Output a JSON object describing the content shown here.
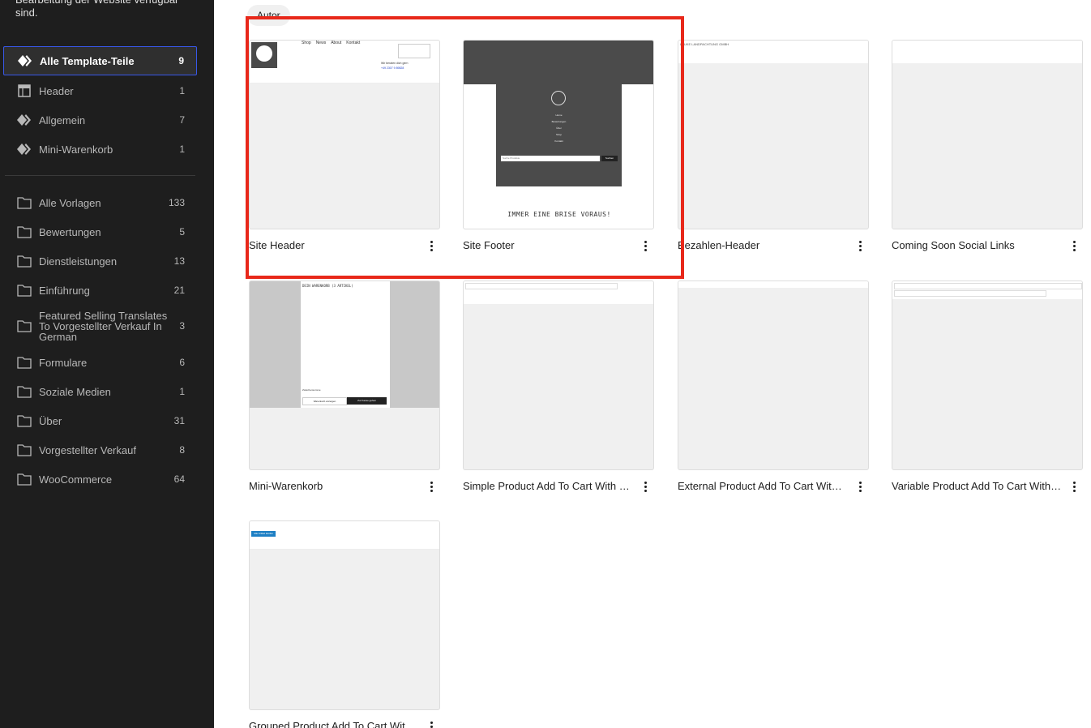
{
  "sidebar": {
    "description": "Bearbeitung der Website verfügbar sind.",
    "areas": [
      {
        "label": "Alle Template-Teile",
        "count": "9",
        "icon": "template-parts-icon",
        "active": true
      },
      {
        "label": "Header",
        "count": "1",
        "icon": "header-icon"
      },
      {
        "label": "Allgemein",
        "count": "7",
        "icon": "template-parts-icon"
      },
      {
        "label": "Mini-Warenkorb",
        "count": "1",
        "icon": "template-parts-icon"
      }
    ],
    "categories": [
      {
        "label": "Alle Vorlagen",
        "count": "133"
      },
      {
        "label": "Bewertungen",
        "count": "5"
      },
      {
        "label": "Dienstleistungen",
        "count": "13"
      },
      {
        "label": "Einführung",
        "count": "21"
      },
      {
        "label": "Featured Selling Translates To Vorgestellter Verkauf In German",
        "count": "3"
      },
      {
        "label": "Formulare",
        "count": "6"
      },
      {
        "label": "Soziale Medien",
        "count": "1"
      },
      {
        "label": "Über",
        "count": "31"
      },
      {
        "label": "Vorgestellter Verkauf",
        "count": "8"
      },
      {
        "label": "WooCommerce",
        "count": "64"
      }
    ]
  },
  "filter": {
    "label": "Autor"
  },
  "cards": [
    {
      "title": "Site Header"
    },
    {
      "title": "Site Footer"
    },
    {
      "title": "Bezahlen-Header"
    },
    {
      "title": "Coming Soon Social Links"
    },
    {
      "title": "Mini-Warenkorb"
    },
    {
      "title": "Simple Product Add To Cart With O..."
    },
    {
      "title": "External Product Add To Cart With ..."
    },
    {
      "title": "Variable Product Add To Cart With ..."
    },
    {
      "title": "Grouped Product Add To Cart With ..."
    }
  ],
  "preview": {
    "header_nav": [
      "Shop",
      "News",
      "About",
      "Kontakt"
    ],
    "header_phone_text": "Wir beraten dich gern",
    "header_phone": "+49 2307 9 89828",
    "footer_tagline": "IMMER EINE BRISE VORAUS!",
    "footer_menu": [
      "Home",
      "Bewertungen",
      "Über",
      "Shop",
      "Kontakt"
    ],
    "footer_search_button": "Suchen",
    "footer_search_placeholder": "Suche Produkte",
    "checkout_brand": "LEUKE LANDPACHTUNG GMBH",
    "cart_heading": "DEIN WARENKORB (3 ARTIKEL)",
    "cart_total_label": "Zwischensumme",
    "cart_view": "Warenkorb anzeigen",
    "cart_checkout": "Zur Kasse gehen",
    "grouped_button": "Alle Artikel kaufen"
  },
  "colors": {
    "sidebar_bg": "#1e1e1e",
    "accent": "#3858e9",
    "highlight": "#e8281a"
  }
}
